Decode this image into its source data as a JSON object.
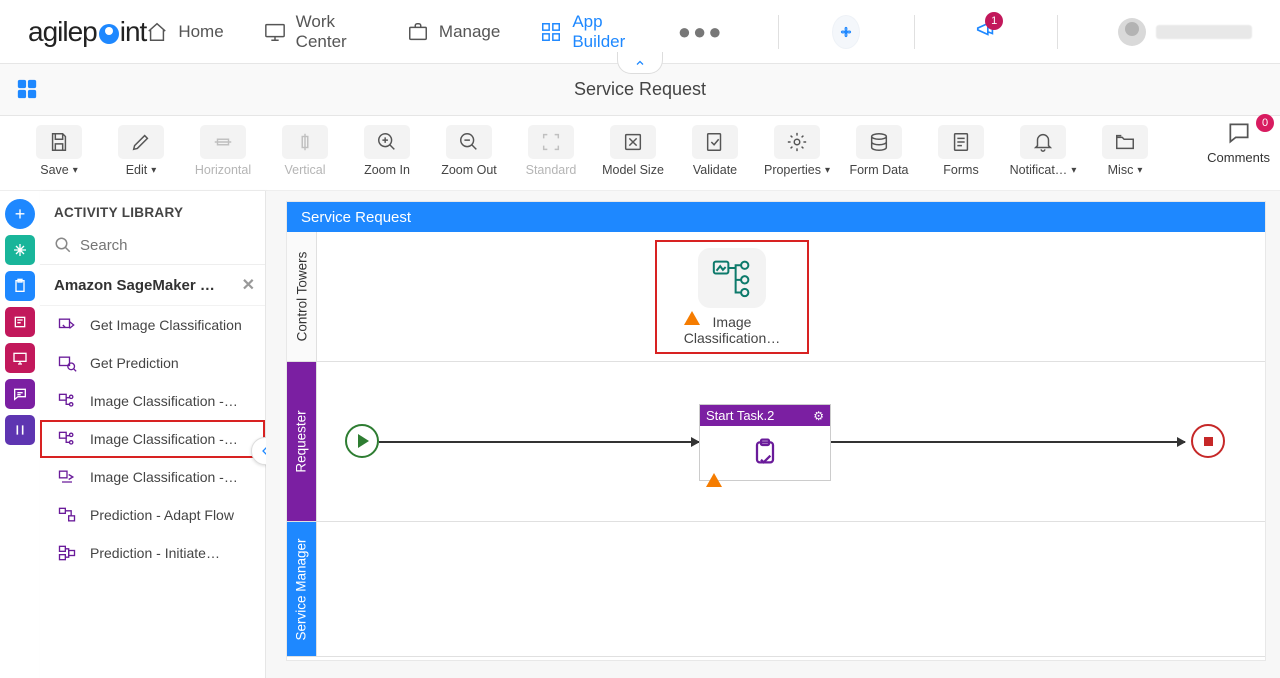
{
  "header": {
    "logo_a": "agilep",
    "logo_b": "int",
    "nav": {
      "home": "Home",
      "work_center": "Work Center",
      "manage": "Manage",
      "app_builder": "App Builder"
    },
    "notif_badge": "1"
  },
  "subheader": {
    "title": "Service Request"
  },
  "toolbar": {
    "save": "Save",
    "edit": "Edit",
    "horizontal": "Horizontal",
    "vertical": "Vertical",
    "zoom_in": "Zoom In",
    "zoom_out": "Zoom Out",
    "standard": "Standard",
    "model_size": "Model Size",
    "validate": "Validate",
    "properties": "Properties",
    "form_data": "Form Data",
    "forms": "Forms",
    "notifications": "Notificat…",
    "misc": "Misc",
    "comments": "Comments",
    "comments_badge": "0"
  },
  "library": {
    "heading": "ACTIVITY LIBRARY",
    "search_placeholder": "Search",
    "group_name": "Amazon SageMaker …",
    "items": [
      "Get Image Classification",
      "Get Prediction",
      "Image Classification -…",
      "Image Classification -…",
      "Image Classification -…",
      "Prediction - Adapt Flow",
      "Prediction - Initiate…"
    ]
  },
  "canvas": {
    "title": "Service Request",
    "lanes": {
      "lane1": "Control Towers",
      "lane2": "Requester",
      "lane3": "Service Manager"
    },
    "dropped_label": "Image Classification…",
    "task_name": "Start Task.2"
  }
}
